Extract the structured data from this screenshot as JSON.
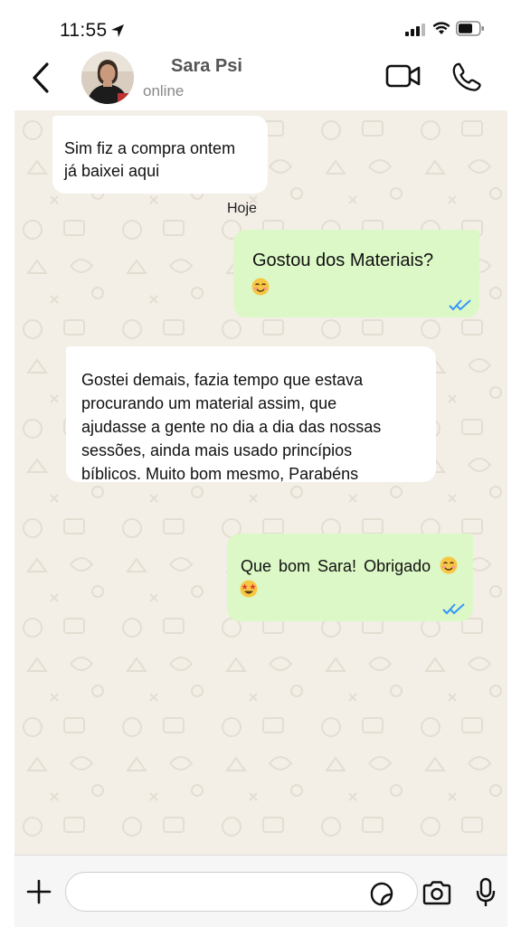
{
  "status_bar": {
    "time": "11:55"
  },
  "contact": {
    "name": "Sara Psi",
    "status": "online"
  },
  "messages": [
    {
      "direction": "in",
      "lines": [
        "Sim fiz a compra ontem",
        "já baixei aqui"
      ]
    },
    {
      "type": "date-separator",
      "label": "Hoje"
    },
    {
      "direction": "out",
      "lines": [
        "Gostou dos Materiais?"
      ],
      "emoji": [
        "smiling-face-icon"
      ],
      "ticks": "read"
    },
    {
      "direction": "in",
      "lines": [
        "Gostei demais, fazia tempo que estava",
        "procurando um material assim, que",
        "ajudasse a gente no dia a dia das nossas",
        "sessões, ainda mais usado princípios",
        "bíblicos. Muito bom mesmo, Parabéns"
      ]
    },
    {
      "direction": "out",
      "lines": [
        "Que bom Sara! Obrigado"
      ],
      "emoji": [
        "smiling-face-icon",
        "star-struck-icon"
      ],
      "ticks": "read"
    }
  ],
  "input": {
    "placeholder": "",
    "value": ""
  },
  "colors": {
    "outgoing_bubble": "#dcf8c6",
    "incoming_bubble": "#ffffff",
    "chat_background": "#f3efe7",
    "read_ticks": "#3497f9"
  }
}
